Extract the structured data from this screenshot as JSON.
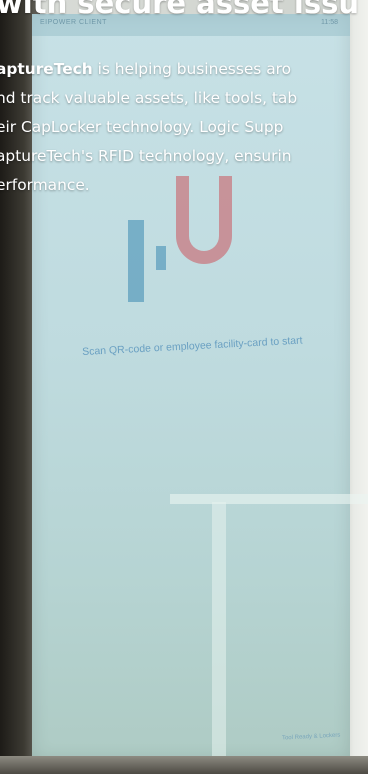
{
  "headline": "with secure asset issu",
  "article": {
    "brand": "aptureTech",
    "line1_rest": " is helping businesses aro",
    "line2": "nd track valuable assets, like tools, tab",
    "line3": "eir CapLocker technology. Logic Supp",
    "line4": "aptureTech's RFID technology, ensurin",
    "line5": "erformance."
  },
  "kiosk": {
    "top_left_label": "EIPOWER CLIENT",
    "top_right_label": "11:58",
    "scan_prompt": "Scan QR-code or employee facility-card to start",
    "bottom_right_label": "Tool Ready & Lockers"
  },
  "colors": {
    "screen": "#c7e1e6",
    "logo_blue": "#5e9fbe",
    "logo_pink": "#c97e85",
    "text": "#ffffff"
  }
}
